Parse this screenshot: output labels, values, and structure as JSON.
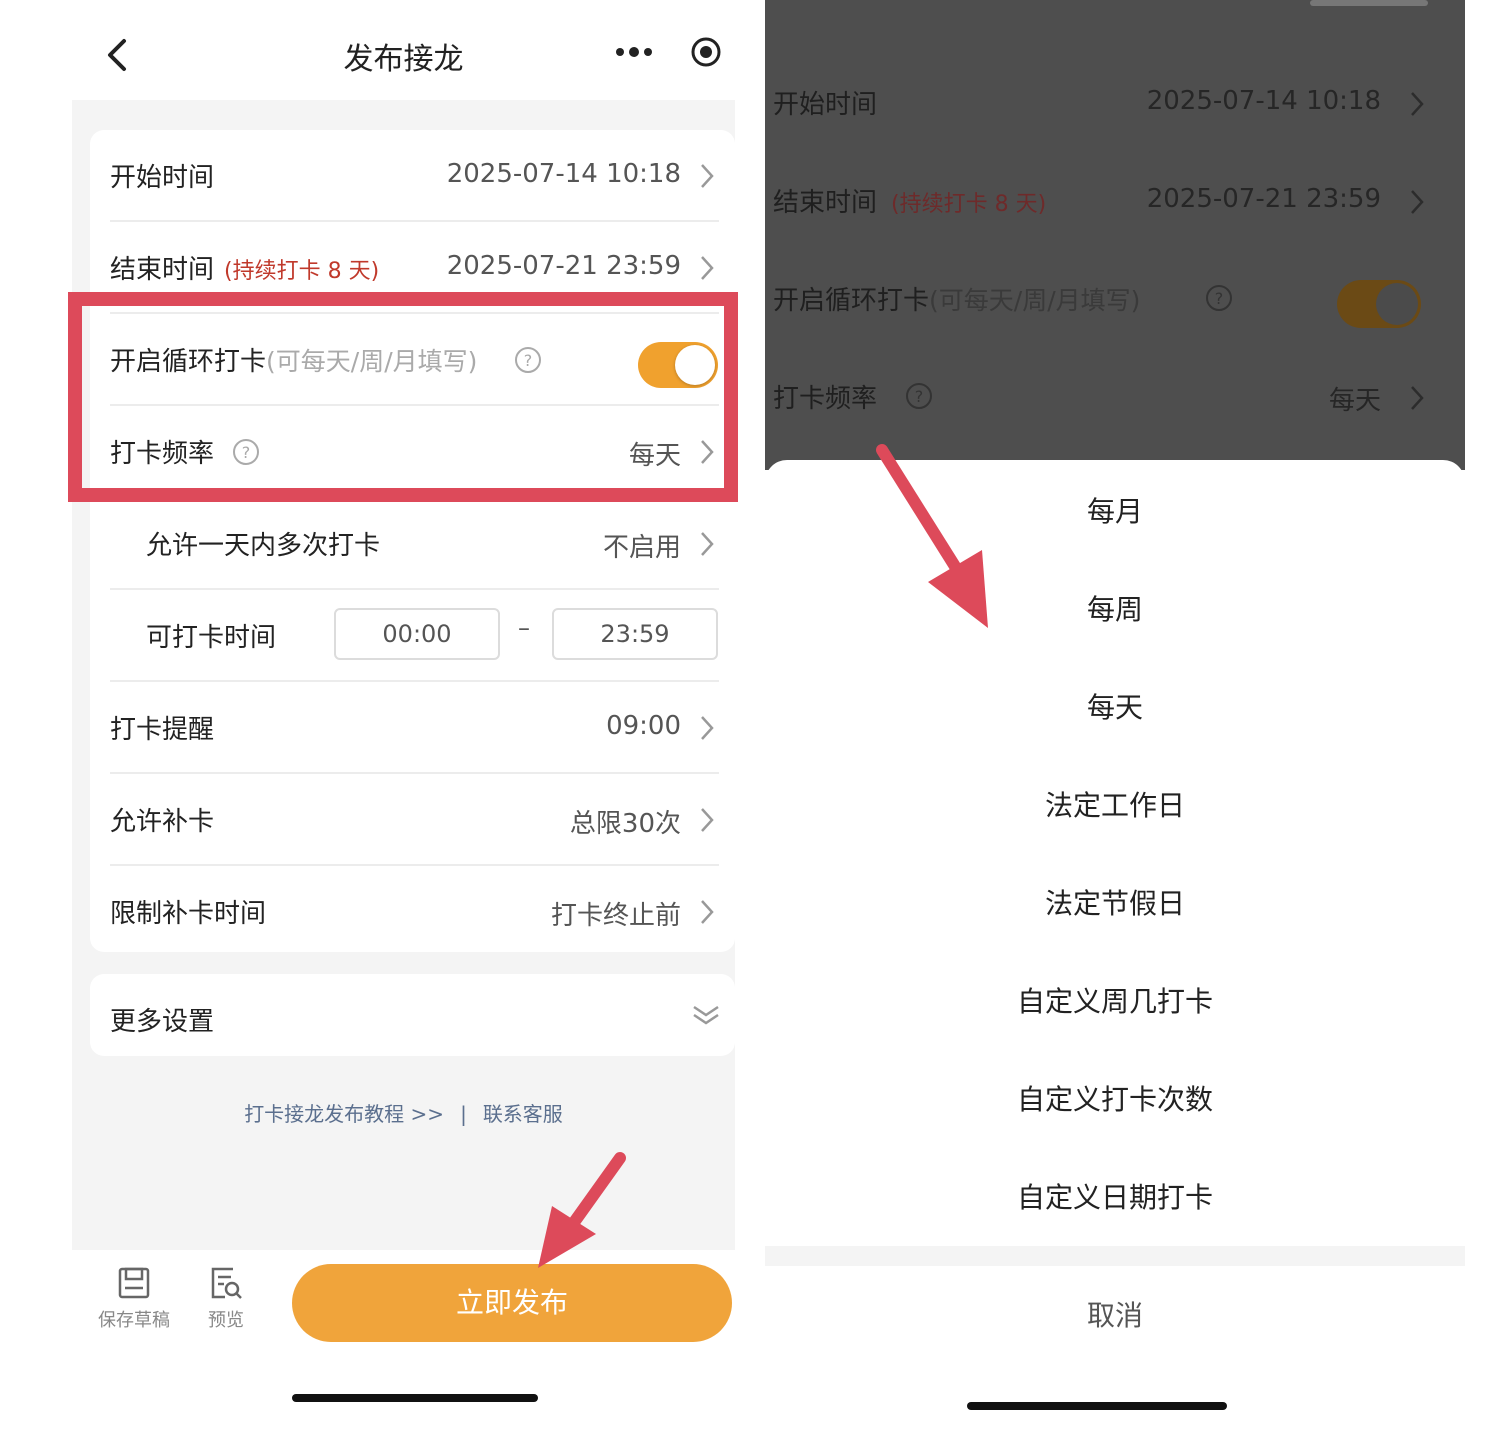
{
  "left_phone": {
    "nav": {
      "title": "发布接龙"
    },
    "rows": {
      "start_time": {
        "label": "开始时间",
        "value": "2025-07-14 10:18"
      },
      "end_time": {
        "label": "结束时间",
        "note": "(持续打卡 8 天)",
        "value": "2025-07-21 23:59"
      },
      "loop": {
        "label": "开启循环打卡",
        "hint": "(可每天/周/月填写)",
        "enabled": true
      },
      "frequency": {
        "label": "打卡频率",
        "value": "每天"
      },
      "multi": {
        "label": "允许一天内多次打卡",
        "value": "不启用"
      },
      "window": {
        "label": "可打卡时间",
        "start": "00:00",
        "separator": "–",
        "end": "23:59"
      },
      "reminder": {
        "label": "打卡提醒",
        "value": "09:00"
      },
      "makeup": {
        "label": "允许补卡",
        "value": "总限30次"
      },
      "makeup_limit": {
        "label": "限制补卡时间",
        "value": "打卡终止前"
      }
    },
    "more_settings": {
      "label": "更多设置"
    },
    "links": {
      "tutorial": "打卡接龙发布教程 >>",
      "separator": "|",
      "support": "联系客服"
    },
    "toolbar": {
      "save_draft": "保存草稿",
      "preview": "预览",
      "publish": "立即发布"
    },
    "colors": {
      "accent": "#f0a43b",
      "highlight": "#dd4a5a",
      "note": "#c0392b",
      "link": "#5b6f8e"
    }
  },
  "right_phone": {
    "dimmed_rows": {
      "start_time": {
        "label": "开始时间",
        "value": "2025-07-14 10:18"
      },
      "end_time": {
        "label": "结束时间",
        "note": "(持续打卡 8 天)",
        "value": "2025-07-21 23:59"
      },
      "loop": {
        "label": "开启循环打卡",
        "hint": "(可每天/周/月填写)"
      },
      "frequency": {
        "label": "打卡频率",
        "value": "每天"
      }
    },
    "sheet": {
      "options": [
        "每月",
        "每周",
        "每天",
        "法定工作日",
        "法定节假日",
        "自定义周几打卡",
        "自定义打卡次数",
        "自定义日期打卡"
      ],
      "cancel": "取消"
    }
  }
}
